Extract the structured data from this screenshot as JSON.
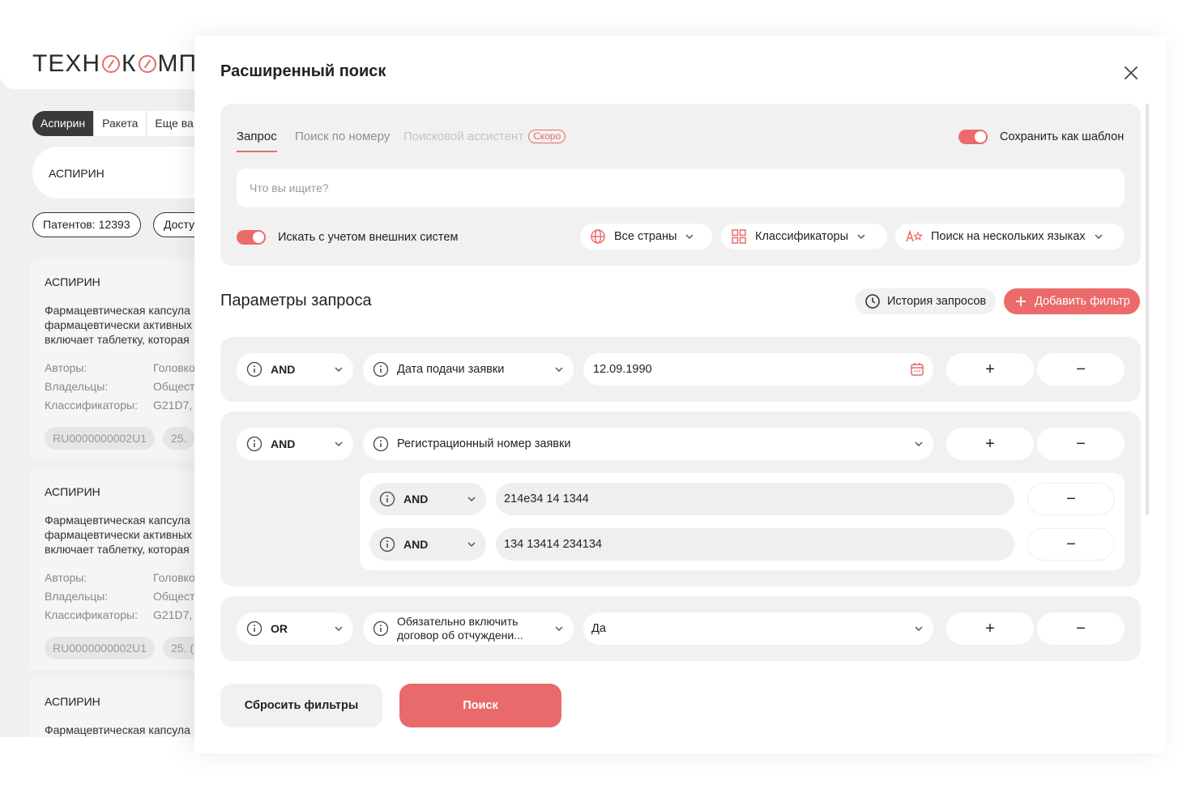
{
  "background": {
    "logo_text": "ТЕХНОКОМП",
    "logo_part1": "ТЕХН",
    "logo_part2": "К",
    "logo_part3": "МП",
    "tabs": [
      "Аспирин",
      "Ракета",
      "Еще ва"
    ],
    "search_value": "АСПИРИН",
    "pills": [
      "Патентов: 12393",
      "Досту"
    ],
    "cards": [
      {
        "title": "АСПИРИН",
        "desc": [
          "Фармацевтическая капсула",
          "фармацевтически активных",
          "включает таблетку, которая"
        ],
        "meta": [
          [
            "Авторы:",
            "Головко"
          ],
          [
            "Владельцы:",
            "Общест"
          ],
          [
            "Классификаторы:",
            "G21D7,"
          ]
        ],
        "chips": [
          "RU0000000002U1",
          "25."
        ]
      },
      {
        "title": "АСПИРИН",
        "desc": [
          "Фармацевтическая капсула",
          "фармацевтически активных",
          "включает таблетку, которая"
        ],
        "meta": [
          [
            "Авторы:",
            "Головко"
          ],
          [
            "Владельцы:",
            "Общест"
          ],
          [
            "Классификаторы:",
            "G21D7,"
          ]
        ],
        "chips": [
          "RU0000000002U1",
          "25. ("
        ]
      },
      {
        "title": "АСПИРИН",
        "desc": [
          "Фармацевтическая капсула"
        ]
      }
    ]
  },
  "modal": {
    "title": "Расширенный поиск",
    "tabs": [
      "Запрос",
      "Поиск по номеру",
      "Поисковой ассистент"
    ],
    "soon_badge": "Скоро",
    "save_template_label": "Сохранить как шаблон",
    "search_placeholder": "Что вы ищите?",
    "external_label": "Искать с учетом внешних систем",
    "countries_label": "Все страны",
    "classifiers_label": "Классификаторы",
    "languages_label": "Поиск на нескольких языках",
    "params_title": "Параметры запроса",
    "history_label": "История запросов",
    "add_filter_label": "Добавить фильтр",
    "filters": [
      {
        "op": "AND",
        "field": "Дата подачи заявки",
        "value": "12.09.1990"
      },
      {
        "op": "AND",
        "field": "Регистрационный номер заявки",
        "subitems": [
          {
            "op": "AND",
            "value": "214e34 14 1344"
          },
          {
            "op": "AND",
            "value": "134 13414 234134"
          }
        ]
      },
      {
        "op": "OR",
        "field_line1": "Обязательно включить",
        "field_line2": "договор об отчуждени...",
        "value": "Да"
      }
    ],
    "plus": "+",
    "minus": "−",
    "reset_label": "Сбросить фильтры",
    "submit_label": "Поиск"
  },
  "colors": {
    "accent": "#ec6a6a",
    "panel": "#f1f1f1",
    "text": "#222222"
  }
}
